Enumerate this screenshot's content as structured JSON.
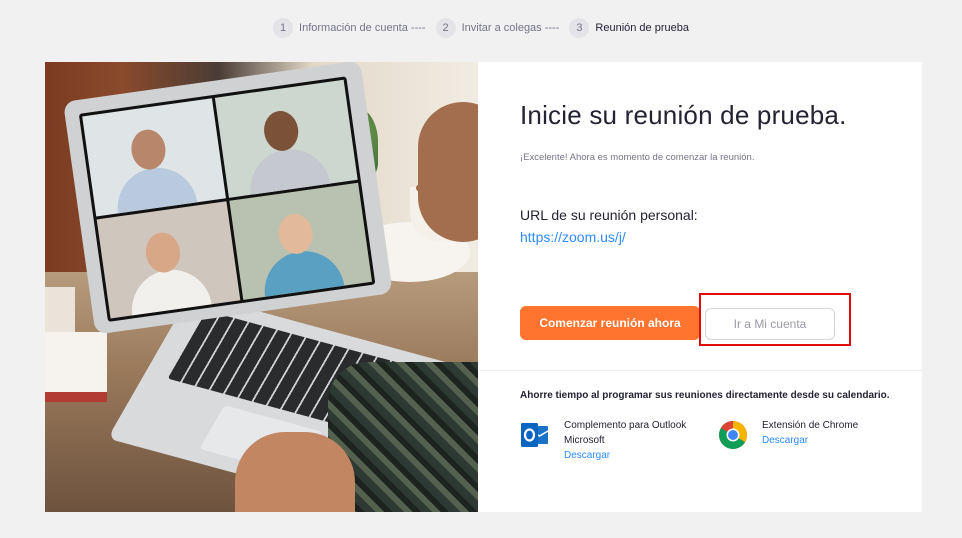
{
  "steps": [
    {
      "num": "1",
      "label": "Información de cuenta ----"
    },
    {
      "num": "2",
      "label": "Invitar a colegas ----"
    },
    {
      "num": "3",
      "label": "Reunión de prueba"
    }
  ],
  "main": {
    "title": "Inicie su reunión de prueba.",
    "subtitle": "¡Excelente! Ahora es momento de comenzar la reunión.",
    "url_label": "URL de su reunión personal:",
    "url_value": "https://zoom.us/j/",
    "start_button": "Comenzar reunión ahora",
    "account_button": "Ir a Mi cuenta"
  },
  "calendar": {
    "heading": "Ahorre tiempo al programar sus reuniones directamente desde su calendario.",
    "integrations": [
      {
        "name": "Complemento para Outlook Microsoft",
        "link": "Descargar",
        "icon": "outlook-icon"
      },
      {
        "name": "Extensión de Chrome",
        "link": "Descargar",
        "icon": "chrome-icon"
      }
    ]
  },
  "colors": {
    "accent": "#ff742e",
    "link": "#2d8cff",
    "highlight": "#e00b0b"
  }
}
